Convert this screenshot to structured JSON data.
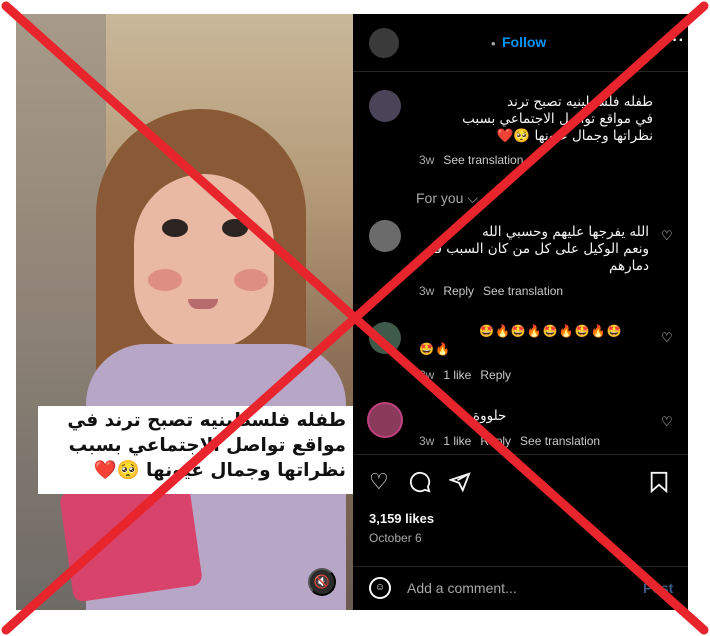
{
  "media": {
    "caption_lines": [
      "طفله فلسطينيه تصبح ترند في",
      "مواقع تواصل الاجتماعي بسبب",
      "نظراتها وجمال عيونها 🥺❤️"
    ],
    "mute_icon": "speaker-mute-icon"
  },
  "header": {
    "dot": "•",
    "follow_label": "Follow",
    "more_label": "···"
  },
  "comments": [
    {
      "text_lines": [
        "طفله فلسطينيه تصبح ترند",
        "في مواقع تواصل الاجتماعي بسبب",
        "نظراتها وجمال عيونها 🥺❤️"
      ],
      "time": "3w",
      "see_translation": "See translation"
    },
    {
      "text_lines": [
        "الله يفرجها عليهم وحسبي الله",
        "ونعم الوكيل على كل من كان السبب في",
        "دمارهم"
      ],
      "time": "3w",
      "reply": "Reply",
      "see_translation": "See translation"
    },
    {
      "text_lines": [
        "🤩🔥🤩🔥🤩🔥🤩🔥🤩",
        "🤩🔥"
      ],
      "time": "3w",
      "likes": "1 like",
      "reply": "Reply"
    },
    {
      "text_lines": [
        "حلووة"
      ],
      "time": "3w",
      "likes": "1 like",
      "reply": "Reply",
      "see_translation": "See translation"
    }
  ],
  "for_you": "For you ⌵",
  "actions": {
    "likes": "3,159 likes",
    "date": "October 6"
  },
  "comment_box": {
    "placeholder": "Add a comment...",
    "post_label": "Post"
  },
  "colors": {
    "accent": "#0095f6",
    "x_mark": "#e8242d",
    "background": "#000000"
  }
}
